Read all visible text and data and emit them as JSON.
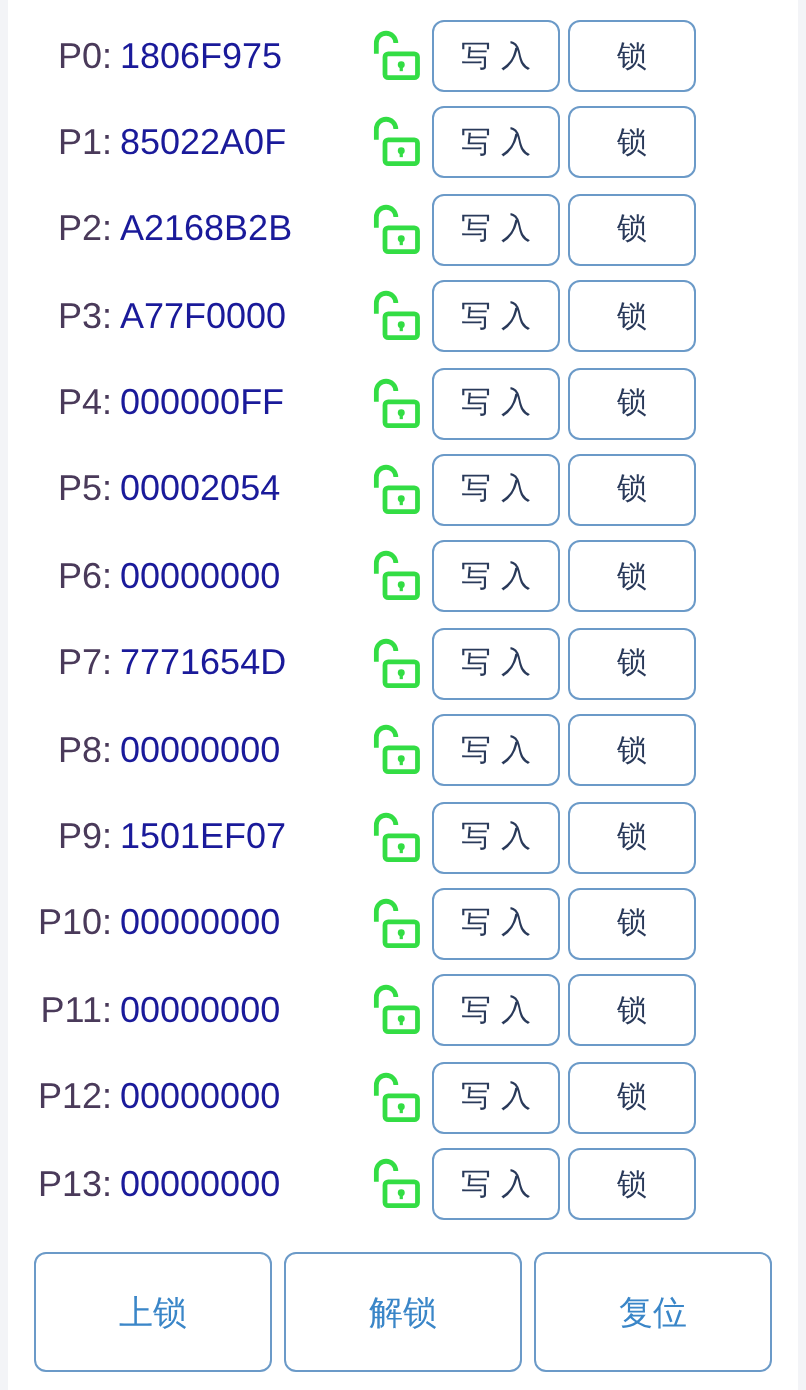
{
  "registers": [
    {
      "label": "P0:",
      "value": "1806F975",
      "locked": false,
      "write": "写 入",
      "lock": "锁"
    },
    {
      "label": "P1:",
      "value": "85022A0F",
      "locked": false,
      "write": "写 入",
      "lock": "锁"
    },
    {
      "label": "P2:",
      "value": "A2168B2B",
      "locked": false,
      "write": "写 入",
      "lock": "锁"
    },
    {
      "label": "P3:",
      "value": "A77F0000",
      "locked": false,
      "write": "写 入",
      "lock": "锁"
    },
    {
      "label": "P4:",
      "value": "000000FF",
      "locked": false,
      "write": "写 入",
      "lock": "锁"
    },
    {
      "label": "P5:",
      "value": "00002054",
      "locked": false,
      "write": "写 入",
      "lock": "锁"
    },
    {
      "label": "P6:",
      "value": "00000000",
      "locked": false,
      "write": "写 入",
      "lock": "锁"
    },
    {
      "label": "P7:",
      "value": "7771654D",
      "locked": false,
      "write": "写 入",
      "lock": "锁"
    },
    {
      "label": "P8:",
      "value": "00000000",
      "locked": false,
      "write": "写 入",
      "lock": "锁"
    },
    {
      "label": "P9:",
      "value": "1501EF07",
      "locked": false,
      "write": "写 入",
      "lock": "锁"
    },
    {
      "label": "P10:",
      "value": "00000000",
      "locked": false,
      "write": "写 入",
      "lock": "锁"
    },
    {
      "label": "P11:",
      "value": "00000000",
      "locked": false,
      "write": "写 入",
      "lock": "锁"
    },
    {
      "label": "P12:",
      "value": "00000000",
      "locked": false,
      "write": "写 入",
      "lock": "锁"
    },
    {
      "label": "P13:",
      "value": "00000000",
      "locked": false,
      "write": "写 入",
      "lock": "锁"
    }
  ],
  "actions": [
    "上锁",
    "解锁",
    "复位"
  ]
}
